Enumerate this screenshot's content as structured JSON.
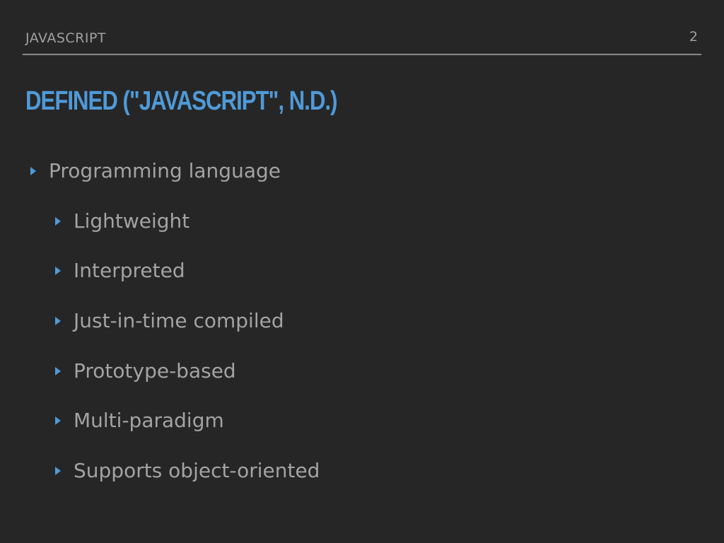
{
  "header": {
    "section_label": "JAVASCRIPT",
    "page_number": "2"
  },
  "title": "DEFINED (\"JAVASCRIPT\", N.D.)",
  "bullets": {
    "main": "Programming language",
    "sub": [
      "Lightweight",
      "Interpreted",
      "Just-in-time compiled",
      "Prototype-based",
      "Multi-paradigm",
      "Supports object-oriented"
    ]
  },
  "colors": {
    "background": "#262626",
    "accent": "#4f9ad8",
    "text": "#a3a3a3"
  },
  "icons": {
    "bullet": "triangle-right-icon"
  }
}
